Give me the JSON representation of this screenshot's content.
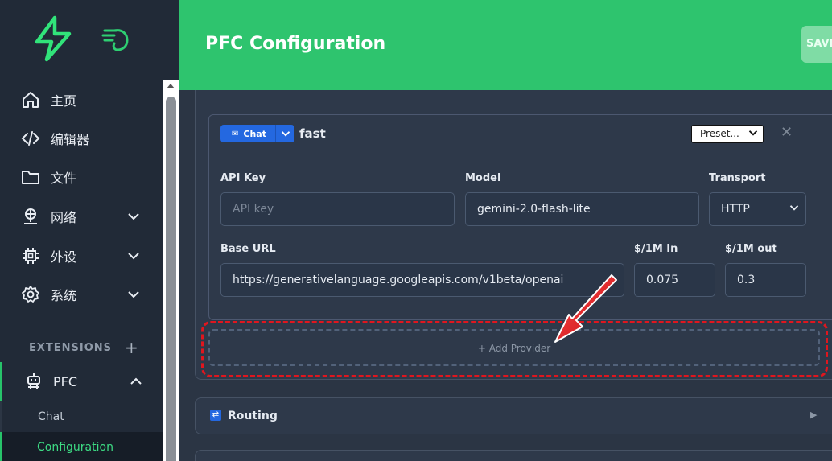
{
  "sidebar": {
    "logo_icon": "lightning-bolt-icon",
    "secondary_icon": "pointing-hand-icon",
    "items": [
      {
        "label": "主页",
        "icon": "home-icon"
      },
      {
        "label": "编辑器",
        "icon": "code-icon"
      },
      {
        "label": "文件",
        "icon": "folder-icon"
      },
      {
        "label": "网络",
        "icon": "network-icon"
      },
      {
        "label": "外设",
        "icon": "chip-icon"
      },
      {
        "label": "系统",
        "icon": "gear-icon"
      }
    ],
    "extensions_title": "EXTENSIONS",
    "extensions_add": "+",
    "extension": {
      "label": "PFC",
      "icon": "robot-icon"
    },
    "sub_items": [
      {
        "label": "Chat"
      },
      {
        "label": "Configuration"
      }
    ]
  },
  "header": {
    "title": "PFC Configuration",
    "save_label": "SAVE"
  },
  "provider": {
    "type_label": "Chat",
    "name": "fast",
    "preset_label": "Preset...",
    "api_key_label": "API Key",
    "api_key_placeholder": "API key",
    "model_label": "Model",
    "model_value": "gemini-2.0-flash-lite",
    "transport_label": "Transport",
    "transport_value": "HTTP",
    "base_url_label": "Base URL",
    "base_url_value": "https://generativelanguage.googleapis.com/v1beta/openai",
    "price_in_label": "$/1M In",
    "price_in_value": "0.075",
    "price_out_label": "$/1M out",
    "price_out_value": "0.3"
  },
  "add_provider_label": "+ Add Provider",
  "routing": {
    "label": "Routing"
  },
  "colors": {
    "accent": "#2ec46e",
    "highlight": "#e0161e",
    "badge": "#2468e0"
  }
}
